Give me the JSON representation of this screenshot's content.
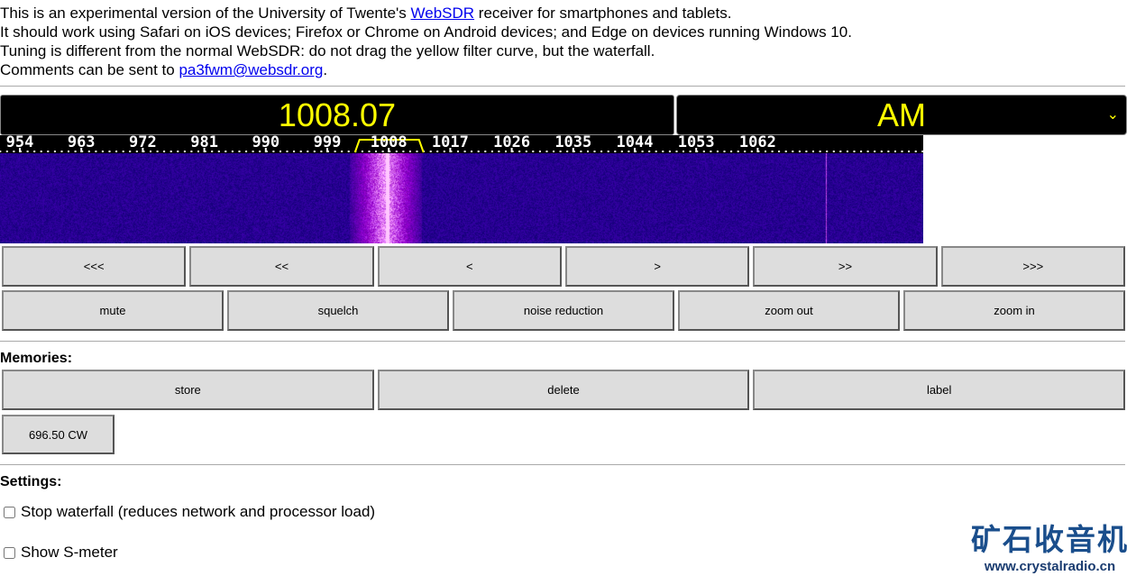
{
  "intro": {
    "l1a": "This is an experimental version of the University of Twente's ",
    "l1link": "WebSDR",
    "l1b": " receiver for smartphones and tablets.",
    "l2": "It should work using Safari on iOS devices; Firefox or Chrome on Android devices; and Edge on devices running Windows 10.",
    "l3": "Tuning is different from the normal WebSDR: do not drag the yellow filter curve, but the waterfall.",
    "l4a": "Comments can be sent to ",
    "l4link": "pa3fwm@websdr.org",
    "l4b": "."
  },
  "frequency": "1008.07",
  "mode": "AM",
  "mode_chevron": "⌄",
  "scale_ticks": [
    "954",
    "963",
    "972",
    "981",
    "990",
    "999",
    "1008",
    "1017",
    "1026",
    "1035",
    "1044",
    "1053",
    "1062"
  ],
  "nav_buttons": [
    "<<<",
    "<<",
    "<",
    ">",
    ">>",
    ">>>"
  ],
  "control_buttons": [
    "mute",
    "squelch",
    "noise reduction",
    "zoom out",
    "zoom in"
  ],
  "memories": {
    "title": "Memories:",
    "buttons": [
      "store",
      "delete",
      "label"
    ],
    "entries": [
      "696.50 CW"
    ]
  },
  "settings": {
    "title": "Settings:",
    "options": [
      {
        "label": "Stop waterfall (reduces network and processor load)",
        "checked": false
      },
      {
        "label": "Show S-meter",
        "checked": false
      }
    ]
  },
  "watermark": {
    "cn": "矿石收音机",
    "url": "www.crystalradio.cn"
  }
}
